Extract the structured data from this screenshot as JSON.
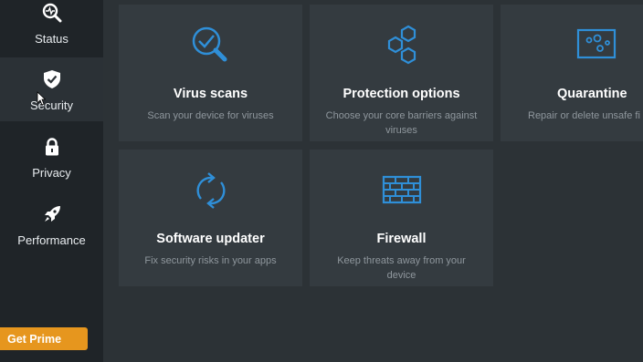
{
  "sidebar": {
    "items": [
      {
        "label": "Status",
        "icon": "status-search-icon"
      },
      {
        "label": "Security",
        "icon": "shield-check-icon"
      },
      {
        "label": "Privacy",
        "icon": "lock-icon"
      },
      {
        "label": "Performance",
        "icon": "rocket-icon"
      }
    ],
    "active": "Security",
    "prime_button": "Get Prime"
  },
  "tiles": [
    {
      "title": "Virus scans",
      "description": "Scan your device for viruses",
      "icon": "magnifier-check-icon"
    },
    {
      "title": "Protection options",
      "description": "Choose your core barriers against viruses",
      "icon": "hexagons-icon"
    },
    {
      "title": "Quarantine",
      "description": "Repair or delete unsafe fi",
      "icon": "quarantine-box-icon"
    },
    {
      "title": "Software updater",
      "description": "Fix security risks in your apps",
      "icon": "refresh-arrows-icon"
    },
    {
      "title": "Firewall",
      "description": "Keep threats away from your device",
      "icon": "brick-wall-icon"
    }
  ],
  "colors": {
    "sidebar_bg": "#1f2428",
    "main_bg": "#2c3236",
    "tile_bg": "#343b40",
    "accent": "#2f8fd8",
    "prime": "#e6961e"
  }
}
